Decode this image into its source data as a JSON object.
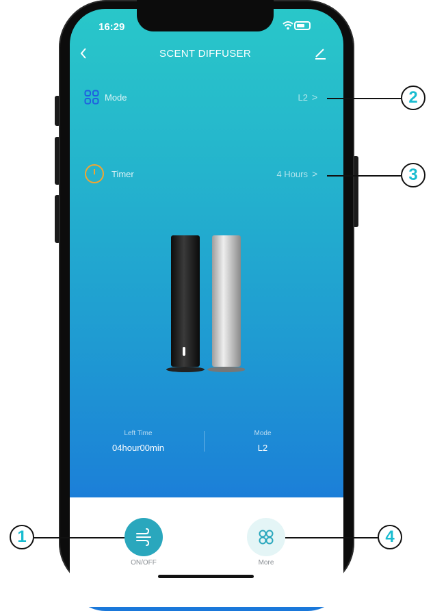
{
  "status_bar": {
    "time": "16:29"
  },
  "header": {
    "title": "SCENT DIFFUSER"
  },
  "settings": {
    "mode": {
      "label": "Mode",
      "value": "L2",
      "chevron": ">"
    },
    "timer": {
      "label": "Timer",
      "value": "4 Hours",
      "chevron": ">"
    }
  },
  "stats": {
    "left_time": {
      "label": "Left Time",
      "value": "04hour00min"
    },
    "mode": {
      "label": "Mode",
      "value": "L2"
    }
  },
  "bottom_actions": {
    "onoff_label": "ON/OFF",
    "more_label": "More"
  },
  "callouts": [
    "1",
    "2",
    "3",
    "4"
  ],
  "icons": {
    "mode": "grid-icon",
    "timer": "clock-icon",
    "onoff": "wind-icon",
    "more": "grid-icon",
    "back": "chevron-left-icon",
    "edit": "pencil-icon"
  },
  "colors": {
    "gradient_top": "#29c7c9",
    "gradient_bottom": "#1a78da",
    "accent": "#2aa7bd",
    "callout_number": "#19bcd0",
    "timer_icon": "#f2a531",
    "mode_icon": "#1f5fe0"
  }
}
